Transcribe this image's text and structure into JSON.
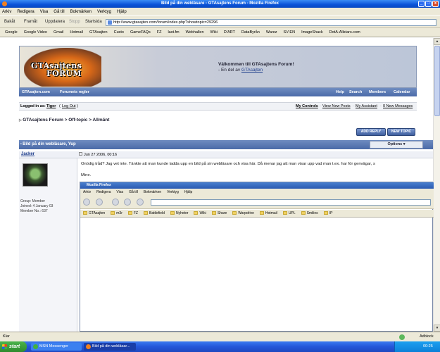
{
  "window": {
    "title": "Bild på din webläsare - GTAsajtens Forum - Mozilla Firefox",
    "min": "_",
    "max": "□",
    "close": "x"
  },
  "menu": [
    "Arkiv",
    "Redigera",
    "Visa",
    "Gå till",
    "Bokmärken",
    "Verktyg",
    "Hjälp"
  ],
  "nav": {
    "back": "Bakåt",
    "forward": "Framåt",
    "reload": "Uppdatera",
    "stop": "Stopp",
    "home": "Startsida",
    "url": "http://www.gtasajten.com/forum/index.php?showtopic=29296"
  },
  "bookmarks": [
    "Google",
    "Google Video",
    "Gmail",
    "Hotmail",
    "GTAsajten",
    "Custo",
    "GameFAQs",
    "FZ",
    "last.fm",
    "Webhallen",
    "Wiki",
    "D'ART",
    "DataByrån",
    "Warez",
    "SV-EN",
    "ImageShack",
    "DotA-Allstars.com"
  ],
  "forum": {
    "logo_line1": "GTAsajtens",
    "logo_line2": "FORUM",
    "welcome": "Välkommen till GTAsajtens Forum!",
    "welcome_sub_prefix": "- En del av",
    "welcome_sub_link": "GTAsajten",
    "nav_left": [
      "GTAsajten.com",
      "Forumets regler"
    ],
    "nav_right": [
      "Help",
      "Search",
      "Members",
      "Calendar"
    ],
    "logged_label": "Logged in as:",
    "user": "Tiger",
    "logout": "Log Out",
    "user_links": [
      "My Controls",
      "View New Posts",
      "My Assistant",
      "0 New Messages"
    ],
    "breadcrumb": "GTAsajtens Forum > Off-topic > Allmänt",
    "add_reply": "ADD REPLY",
    "new_topic": "NEW TOPIC",
    "topic_title": "Bild på din webläsare, Yup",
    "options": "Options ▾",
    "author": "Jacker",
    "post_date": "Jun 27 2006, 00:16",
    "author_group": "Group: Member",
    "author_joined": "Joined: 4 January 03",
    "author_id": "Member No.: 637",
    "post_line1": "Onödig tråd? Jag vet inte. Tänkte att man kunde ladda upp en bild på sin webläsare och visa här. Då menar jag att man visar upp vad man t.ex. har för genvägar, s",
    "post_line2": "Mine."
  },
  "shot": {
    "title": "Mozilla Firefox",
    "menu": [
      "Arkiv",
      "Redigera",
      "Visa",
      "Gå till",
      "Bokmärken",
      "Verktyg",
      "Hjälp"
    ],
    "bookmarks": [
      "GTAsajten",
      "m3r",
      "FZ",
      "Battlefield",
      "Nyheter",
      "Wiki",
      "Share",
      "Warpdrive",
      "Hotmail",
      "UPL",
      "Smilies",
      "IP"
    ]
  },
  "status": {
    "text": "Klar",
    "addon": "Adblock"
  },
  "taskbar": {
    "start": "start",
    "tasks": [
      "MSN Messenger",
      "Bild på din webläsar..."
    ],
    "time": "00:25"
  },
  "colors": {
    "titlebar": "#0a52d8",
    "forum_strip": "#4a6aa8",
    "link": "#1a3a8a",
    "taskbar": "#2456d8",
    "start": "#2e8a2e"
  }
}
